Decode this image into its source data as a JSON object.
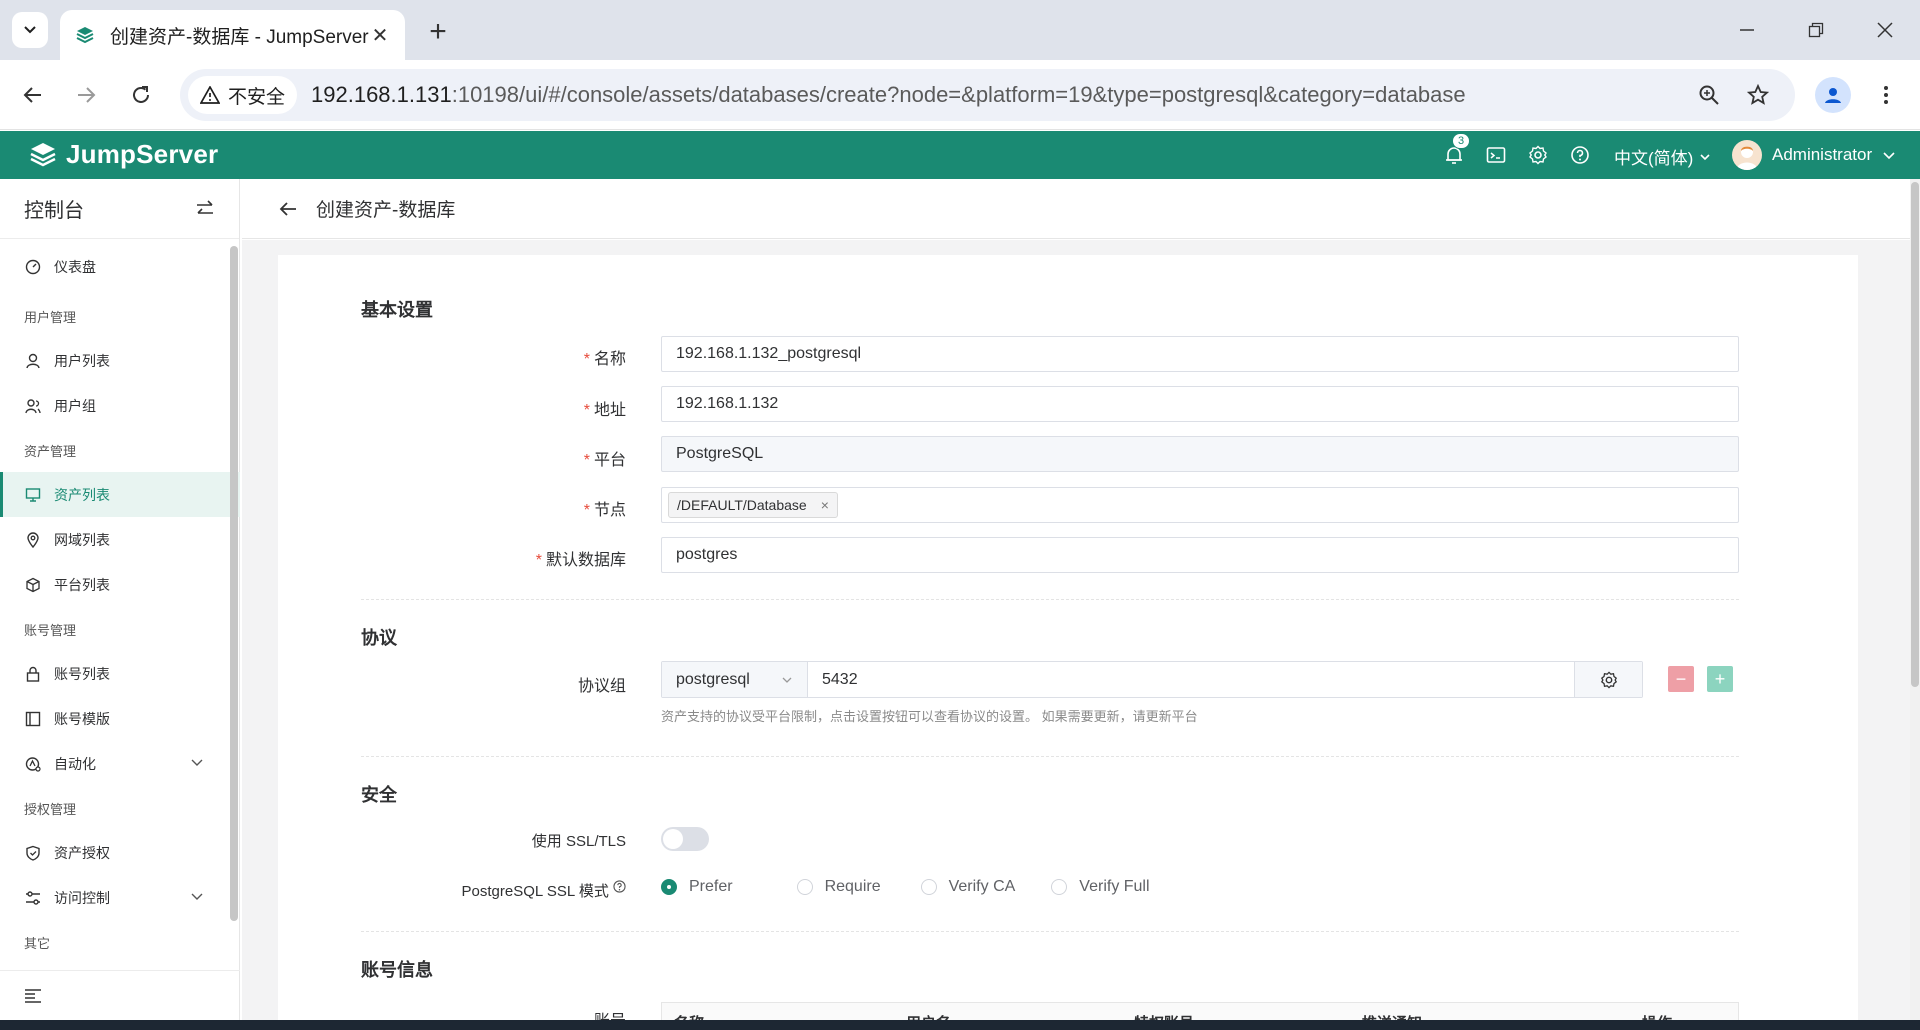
{
  "browser": {
    "tab_title": "创建资产-数据库 - JumpServer",
    "security_label": "不安全",
    "url_host": "192.168.1.131",
    "url_rest": ":10198/ui/#/console/assets/databases/create?node=&platform=19&type=postgresql&category=database"
  },
  "header": {
    "brand": "JumpServer",
    "notification_count": "3",
    "language": "中文(简体)",
    "user": "Administrator",
    "brand_color": "#1a8a73"
  },
  "sidebar": {
    "title": "控制台",
    "dashboard": "仪表盘",
    "groups": {
      "users": "用户管理",
      "assets": "资产管理",
      "accounts": "账号管理",
      "perms": "授权管理",
      "other": "其它"
    },
    "items": {
      "user_list": "用户列表",
      "user_group": "用户组",
      "asset_list": "资产列表",
      "zone_list": "网域列表",
      "platform_list": "平台列表",
      "account_list": "账号列表",
      "account_template": "账号模版",
      "automation": "自动化",
      "asset_perm": "资产授权",
      "access_control": "访问控制"
    }
  },
  "page": {
    "title": "创建资产-数据库"
  },
  "form": {
    "basic_title": "基本设置",
    "name_label": "名称",
    "name_value": "192.168.1.132_postgresql",
    "address_label": "地址",
    "address_value": "192.168.1.132",
    "platform_label": "平台",
    "platform_value": "PostgreSQL",
    "node_label": "节点",
    "node_tag": "/DEFAULT/Database",
    "db_label": "默认数据库",
    "db_value": "postgres",
    "protocol_title": "协议",
    "protocol_group_label": "协议组",
    "protocol_name": "postgresql",
    "protocol_port": "5432",
    "protocol_hint": "资产支持的协议受平台限制，点击设置按钮可以查看协议的设置。 如果需要更新，请更新平台",
    "security_title": "安全",
    "ssl_label": "使用 SSL/TLS",
    "ssl_mode_label": "PostgreSQL SSL 模式",
    "ssl_modes": [
      "Prefer",
      "Require",
      "Verify CA",
      "Verify Full"
    ],
    "ssl_mode_selected": "Prefer",
    "account_title": "账号信息",
    "account_label": "账号",
    "account_columns": [
      "名称",
      "用户名",
      "特权账号",
      "推送通知",
      "操作"
    ]
  }
}
